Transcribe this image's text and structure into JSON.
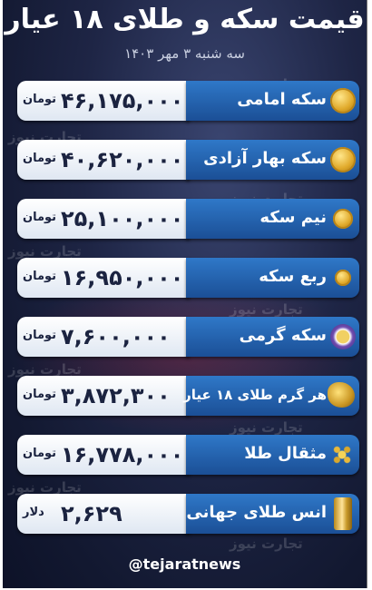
{
  "title": "قیمت سکه و طلای ۱۸ عیار",
  "date": "سه شنبه ۳ مهر ۱۴۰۳",
  "watermark": "تجارت نیوز",
  "items": [
    {
      "label": "سکه امامی",
      "value": "۴۶,۱۷۵,۰۰۰",
      "unit": "تومان",
      "icon": "gold-coin-icon"
    },
    {
      "label": "سکه بهار آزادی",
      "value": "۴۰,۶۲۰,۰۰۰",
      "unit": "تومان",
      "icon": "gold-coin-icon"
    },
    {
      "label": "نیم سکه",
      "value": "۲۵,۱۰۰,۰۰۰",
      "unit": "تومان",
      "icon": "half-coin-icon"
    },
    {
      "label": "ربع سکه",
      "value": "۱۶,۹۵۰,۰۰۰",
      "unit": "تومان",
      "icon": "quarter-coin-icon"
    },
    {
      "label": "سکه گرمی",
      "value": "۷,۶۰۰,۰۰۰",
      "unit": "تومان",
      "icon": "gram-coin-icon"
    },
    {
      "label": "هر گرم طلای ۱۸ عیار",
      "value": "۳,۸۷۲,۳۰۰",
      "unit": "تومان",
      "icon": "gold-nugget-icon"
    },
    {
      "label": "مثقال طلا",
      "value": "۱۶,۷۷۸,۰۰۰",
      "unit": "تومان",
      "icon": "gold-granules-icon"
    },
    {
      "label": "انس طلای جهانی",
      "value": "۲,۶۲۹",
      "unit": "دلار",
      "icon": "gold-bar-icon"
    }
  ],
  "footer": {
    "handle": "@tejaratnews"
  },
  "colors": {
    "background": "#1e2545",
    "label_box": "#2f78c8",
    "value_box": "#ffffff",
    "value_text": "#1b2340"
  }
}
